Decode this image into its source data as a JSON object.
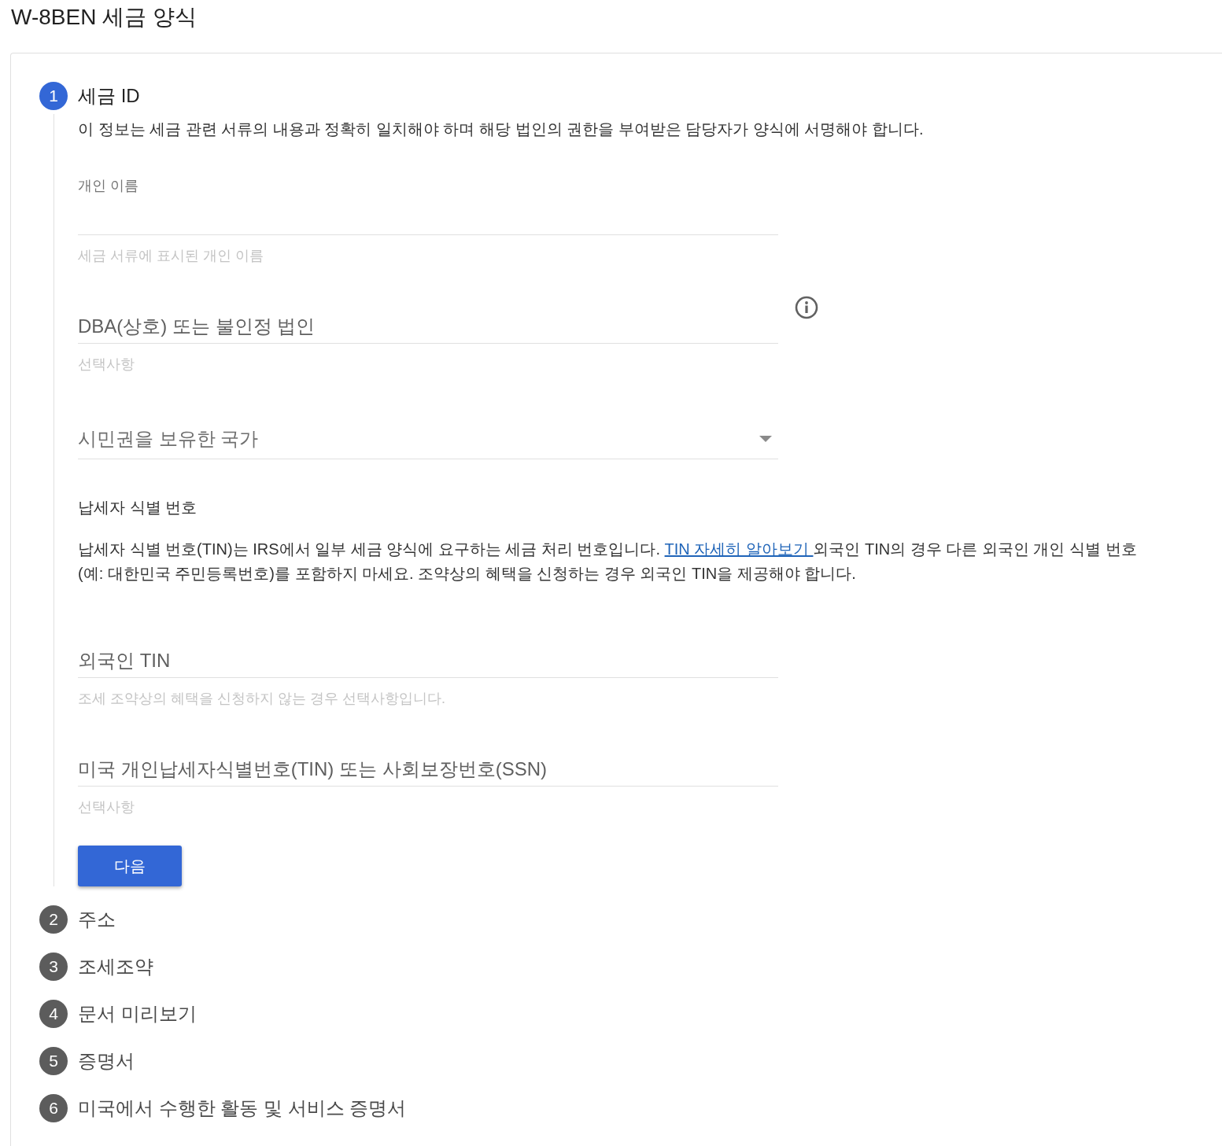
{
  "page": {
    "title": "W-8BEN 세금 양식"
  },
  "steps": [
    {
      "number": "1",
      "title": "세금 ID",
      "selected": true,
      "items": [
        {
          "kind": "description",
          "text": "이 정보는 세금 관련 서류의 내용과 정확히 일치해야 하며 해당 법인의 권한을 부여받은 담당자가 양식에 서명해야 합니다."
        },
        {
          "kind": "text",
          "label": "개인 이름",
          "helper": "세금 서류에 표시된 개인 이름"
        },
        {
          "kind": "text",
          "placeholder": "DBA(상호) 또는 불인정 법인",
          "helper": "선택사항",
          "info": true
        },
        {
          "kind": "select",
          "placeholder": "시민권을 보유한 국가"
        },
        {
          "kind": "heading",
          "text": "납세자 식별 번호"
        },
        {
          "kind": "paragraph",
          "text": "납세자 식별 번호(TIN)는 IRS에서 일부 세금 양식에 요구하는 세금 처리 번호입니다. ",
          "link": "TIN 자세히 알아보기 ",
          "text_after": "외국인 TIN의 경우 다른 외국인 개인 식별 번호 (예: 대한민국 주민등록번호)를 포함하지 마세요. 조약상의 혜택을 신청하는 경우 외국인 TIN을 제공해야 합니다."
        },
        {
          "kind": "text",
          "placeholder": "외국인 TIN",
          "helper": "조세 조약상의 혜택을 신청하지 않는 경우 선택사항입니다."
        },
        {
          "kind": "text",
          "placeholder": "미국 개인납세자식별번호(TIN) 또는 사회보장번호(SSN)",
          "helper": "선택사항"
        },
        {
          "kind": "button",
          "label": "다음"
        }
      ]
    },
    {
      "number": "2",
      "title": "주소",
      "selected": false
    },
    {
      "number": "3",
      "title": "조세조약",
      "selected": false
    },
    {
      "number": "4",
      "title": "문서 미리보기",
      "selected": false
    },
    {
      "number": "5",
      "title": "증명서",
      "selected": false
    },
    {
      "number": "6",
      "title": "미국에서 수행한 활동 및 서비스 증명서",
      "selected": false
    }
  ]
}
